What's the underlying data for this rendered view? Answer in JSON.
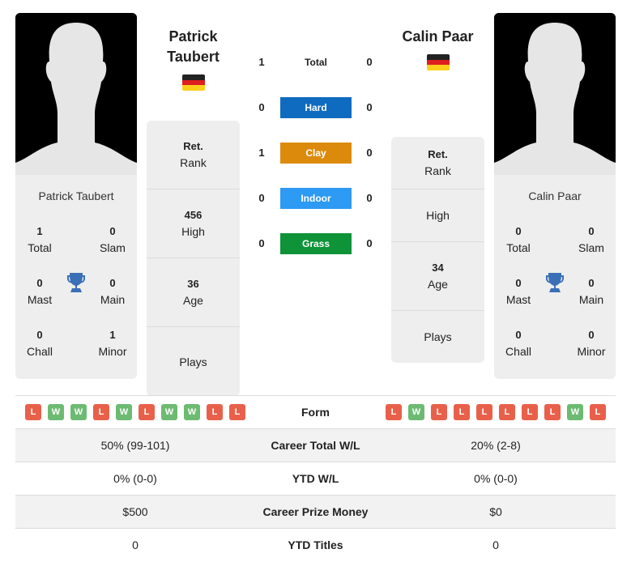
{
  "player1": {
    "name_line1": "Patrick",
    "name_line2": "Taubert",
    "full_name": "Patrick Taubert",
    "country": "Germany",
    "titles": {
      "total": {
        "value": "1",
        "label": "Total"
      },
      "slam": {
        "value": "0",
        "label": "Slam"
      },
      "mast": {
        "value": "0",
        "label": "Mast"
      },
      "main": {
        "value": "0",
        "label": "Main"
      },
      "chall": {
        "value": "0",
        "label": "Chall"
      },
      "minor": {
        "value": "1",
        "label": "Minor"
      }
    },
    "rank": {
      "value": "Ret.",
      "label": "Rank"
    },
    "high": {
      "value": "456",
      "label": "High"
    },
    "age": {
      "value": "36",
      "label": "Age"
    },
    "plays": {
      "value": "",
      "label": "Plays"
    },
    "form": [
      "L",
      "W",
      "W",
      "L",
      "W",
      "L",
      "W",
      "W",
      "L",
      "L"
    ],
    "career_wl": "50% (99-101)",
    "ytd_wl": "0% (0-0)",
    "prize": "$500",
    "ytd_titles": "0"
  },
  "player2": {
    "name_line1": "Calin Paar",
    "full_name": "Calin Paar",
    "country": "Germany",
    "titles": {
      "total": {
        "value": "0",
        "label": "Total"
      },
      "slam": {
        "value": "0",
        "label": "Slam"
      },
      "mast": {
        "value": "0",
        "label": "Mast"
      },
      "main": {
        "value": "0",
        "label": "Main"
      },
      "chall": {
        "value": "0",
        "label": "Chall"
      },
      "minor": {
        "value": "0",
        "label": "Minor"
      }
    },
    "rank": {
      "value": "Ret.",
      "label": "Rank"
    },
    "high": {
      "value": "",
      "label": "High"
    },
    "age": {
      "value": "34",
      "label": "Age"
    },
    "plays": {
      "value": "",
      "label": "Plays"
    },
    "form": [
      "L",
      "W",
      "L",
      "L",
      "L",
      "L",
      "L",
      "L",
      "W",
      "L"
    ],
    "career_wl": "20% (2-8)",
    "ytd_wl": "0% (0-0)",
    "prize": "$0",
    "ytd_titles": "0"
  },
  "h2h": [
    {
      "label": "Total",
      "p1": "1",
      "p2": "0",
      "color": ""
    },
    {
      "label": "Hard",
      "p1": "0",
      "p2": "0",
      "color": "#0e6bbf"
    },
    {
      "label": "Clay",
      "p1": "1",
      "p2": "0",
      "color": "#dc8a0b"
    },
    {
      "label": "Indoor",
      "p1": "0",
      "p2": "0",
      "color": "#2d9af3"
    },
    {
      "label": "Grass",
      "p1": "0",
      "p2": "0",
      "color": "#0e9339"
    }
  ],
  "stats_labels": {
    "form": "Form",
    "career_wl": "Career Total W/L",
    "ytd_wl": "YTD W/L",
    "prize": "Career Prize Money",
    "ytd_titles": "YTD Titles"
  },
  "colors": {
    "win": "#6dbb72",
    "loss": "#e9604a",
    "trophy": "#3b6fb6"
  }
}
